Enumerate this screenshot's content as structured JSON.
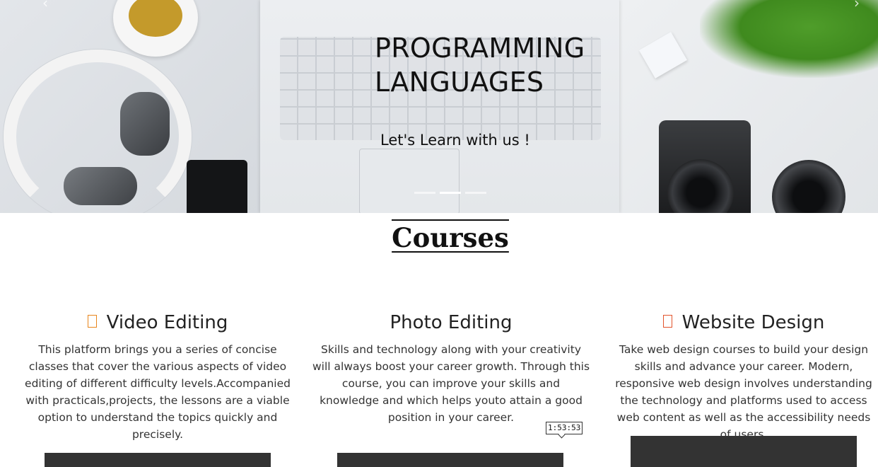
{
  "hero": {
    "title": "PROGRAMMING\nLANGUAGES",
    "subtitle": "Let's Learn with us !",
    "prev_icon": "chevron-left-icon",
    "next_icon": "chevron-right-icon",
    "indicators_total": 3,
    "active_indicator": 2
  },
  "courses": {
    "heading": "Courses",
    "items": [
      {
        "title": "Video Editing",
        "icon": "video-icon",
        "icon_color": "#e8851c",
        "description": "This platform brings you a series of concise classes that cover the various aspects of video editing of different difficulty levels.Accompanied with practicals,projects, the lessons are a viable option to understand the topics quickly and precisely."
      },
      {
        "title": "Photo Editing",
        "description": "Skills and technology along with your creativity will always boost your career growth. Through this course, you can improve your skills and knowledge and which helps youto attain a good position in your career."
      },
      {
        "title": "Website Design",
        "icon": "web-design-icon",
        "icon_color": "#e2542c",
        "description": "Take web design courses to build your design skills and advance your career. Modern, responsive web design involves understanding the technology and platforms used to access web content as well as the accessibility needs of users."
      }
    ]
  },
  "timer": {
    "value": "1:53:53"
  }
}
